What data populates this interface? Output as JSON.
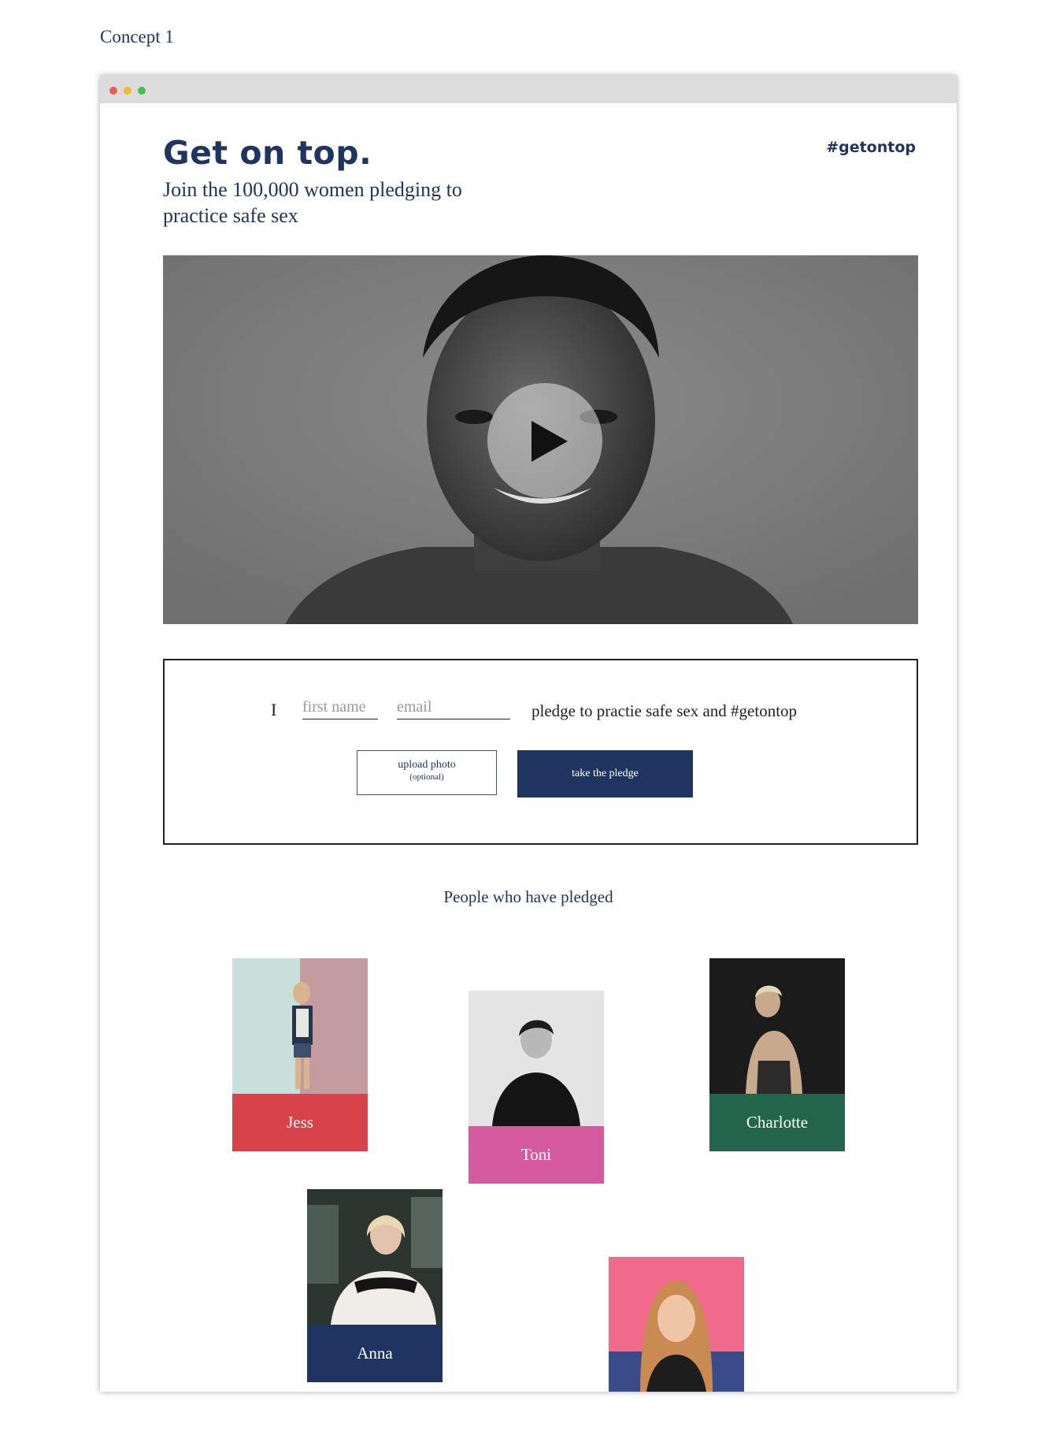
{
  "page_label": "Concept 1",
  "hero": {
    "headline": "Get on top.",
    "hashtag": "#getontop",
    "subheading": "Join the 100,000 women pledging to practice safe sex"
  },
  "pledge": {
    "prefix": "I",
    "first_name_placeholder": "first name",
    "email_placeholder": "email",
    "statement": "pledge to practie safe sex and #getontop",
    "upload_label": "upload photo",
    "upload_note": "(optional)",
    "submit_label": "take the pledge"
  },
  "people": {
    "heading": "People who have pledged",
    "cards": [
      {
        "name": "Jess",
        "color": "#d6434b"
      },
      {
        "name": "Toni",
        "color": "#d45ba0"
      },
      {
        "name": "Charlotte",
        "color": "#22654a"
      },
      {
        "name": "Anna",
        "color": "#1f3461"
      },
      {
        "name": "",
        "color": "#f06a8b"
      }
    ]
  },
  "colors": {
    "brand_navy": "#1f3461"
  }
}
